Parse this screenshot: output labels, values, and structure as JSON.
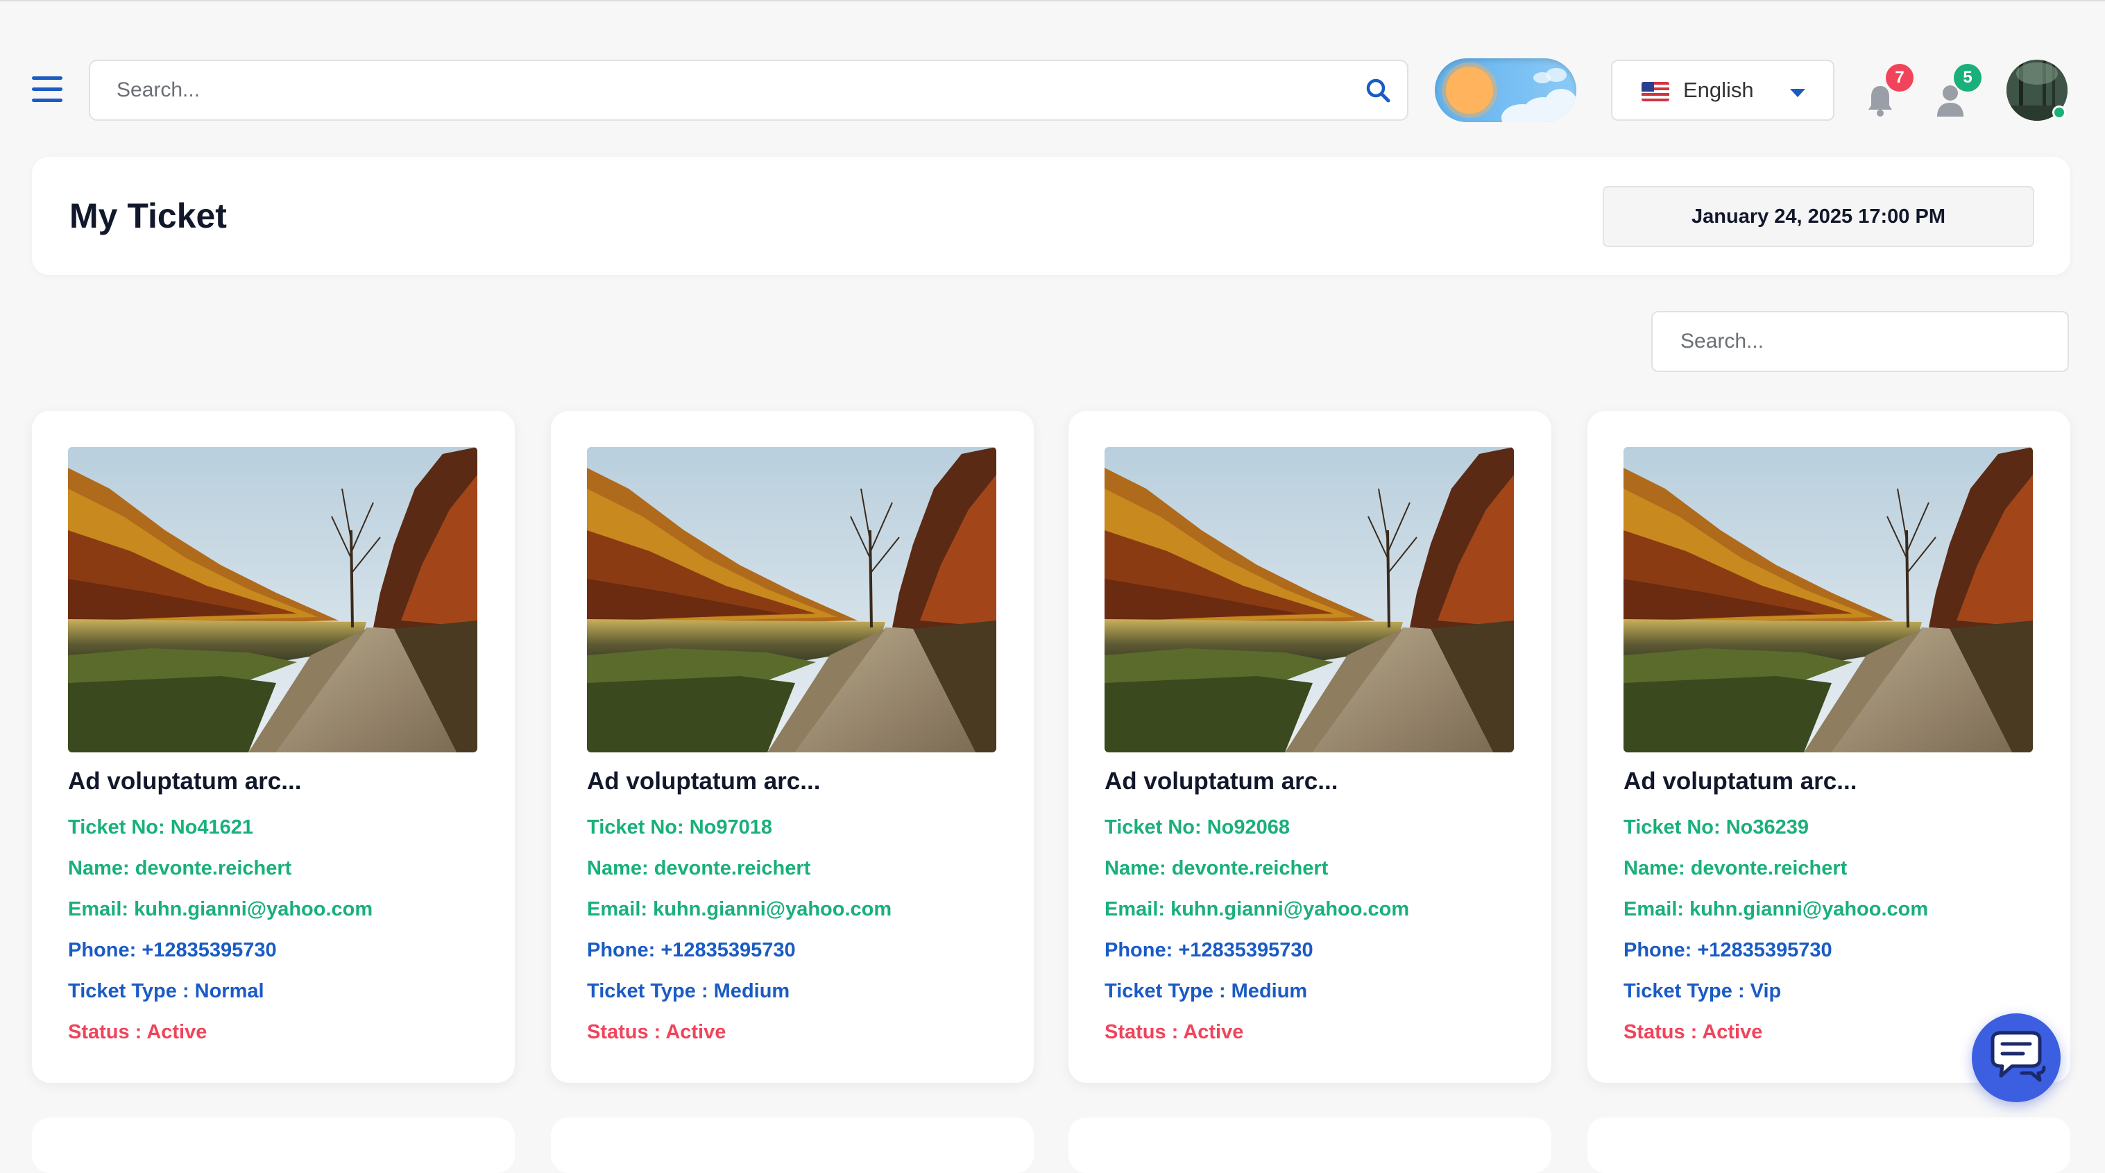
{
  "topbar": {
    "search_placeholder": "Search...",
    "language": "English",
    "notifications_count": "7",
    "users_count": "5",
    "colors": {
      "accent": "#1a5bc4",
      "notif_badge": "#f0445b",
      "user_badge": "#19b07a"
    }
  },
  "page": {
    "title": "My Ticket",
    "datetime": "January 24, 2025 17:00 PM"
  },
  "list_search": {
    "placeholder": "Search..."
  },
  "tickets": [
    {
      "title": "Ad voluptatum arc...",
      "ticket_no": "Ticket No: No41621",
      "name": "Name: devonte.reichert",
      "email": "Email: kuhn.gianni@yahoo.com",
      "phone": "Phone: +12835395730",
      "type": "Ticket Type : Normal",
      "status": "Status : Active"
    },
    {
      "title": "Ad voluptatum arc...",
      "ticket_no": "Ticket No: No97018",
      "name": "Name: devonte.reichert",
      "email": "Email: kuhn.gianni@yahoo.com",
      "phone": "Phone: +12835395730",
      "type": "Ticket Type : Medium",
      "status": "Status : Active"
    },
    {
      "title": "Ad voluptatum arc...",
      "ticket_no": "Ticket No: No92068",
      "name": "Name: devonte.reichert",
      "email": "Email: kuhn.gianni@yahoo.com",
      "phone": "Phone: +12835395730",
      "type": "Ticket Type : Medium",
      "status": "Status : Active"
    },
    {
      "title": "Ad voluptatum arc...",
      "ticket_no": "Ticket No: No36239",
      "name": "Name: devonte.reichert",
      "email": "Email: kuhn.gianni@yahoo.com",
      "phone": "Phone: +12835395730",
      "type": "Ticket Type : Vip",
      "status": "Status : Active"
    }
  ],
  "icons": [
    "menu-icon",
    "search-icon",
    "sun-icon",
    "us-flag-icon",
    "caret-down-icon",
    "bell-icon",
    "user-icon",
    "chat-icon"
  ]
}
